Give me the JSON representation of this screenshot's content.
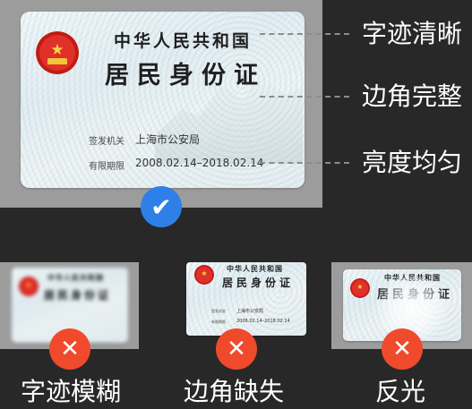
{
  "id_card": {
    "country": "中华人民共和国",
    "title": "居民身份证",
    "issuer_label": "签发机关",
    "issuer_value": "上海市公安局",
    "validity_label": "有限期限",
    "validity_value": "2008.02.14–2018.02.14",
    "emblem_icon": "national-emblem-icon"
  },
  "good_example": {
    "badge_icon": "checkmark-icon",
    "badge_glyph": "✔",
    "badge_color": "#2e80e8"
  },
  "callouts": [
    {
      "label": "字迹清晰"
    },
    {
      "label": "边角完整"
    },
    {
      "label": "亮度均匀"
    }
  ],
  "bad_examples": [
    {
      "caption": "字迹模糊",
      "badge_glyph": "✕",
      "badge_icon": "close-icon"
    },
    {
      "caption": "边角缺失",
      "badge_glyph": "✕",
      "badge_icon": "close-icon"
    },
    {
      "caption": "反光",
      "badge_glyph": "✕",
      "badge_icon": "close-icon"
    }
  ],
  "colors": {
    "background": "#282828",
    "panel": "#9c9c9c",
    "good_badge": "#2e80e8",
    "bad_badge": "#f04a2c"
  }
}
